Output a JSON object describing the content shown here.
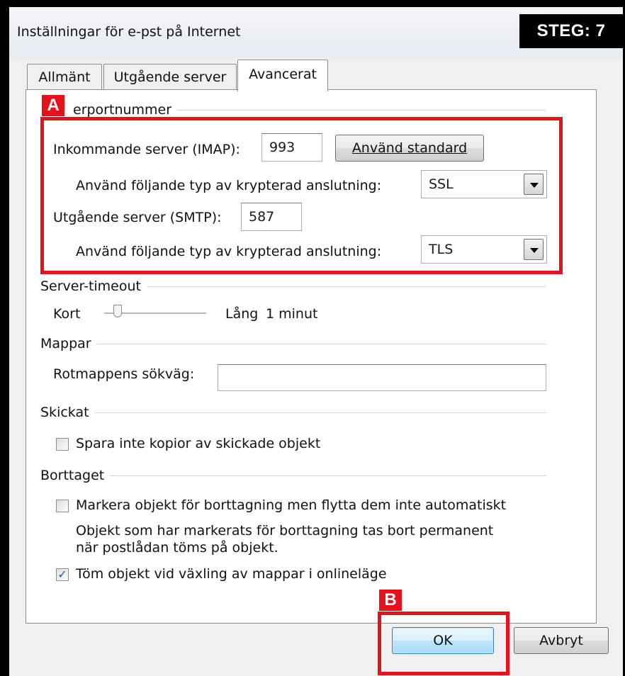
{
  "window": {
    "title": "Inställningar för e-pst på Internet"
  },
  "step_badge": "STEG: 7",
  "tabs": [
    {
      "label": "Allmänt"
    },
    {
      "label": "Utgående server"
    },
    {
      "label": "Avancerat"
    }
  ],
  "ports": {
    "group_label": "A",
    "group_label_rest": "erportnummer",
    "incoming_label": "Inkommande server (IMAP):",
    "incoming_value": "993",
    "use_default_label": "Använd standard",
    "incoming_encryption_label": "Använd följande typ av krypterad anslutning:",
    "incoming_encryption_value": "SSL",
    "outgoing_label": "Utgående server (SMTP):",
    "outgoing_value": "587",
    "outgoing_encryption_label": "Använd följande typ av krypterad anslutning:",
    "outgoing_encryption_value": "TLS"
  },
  "timeout": {
    "group_label": "Server-timeout",
    "short_label": "Kort",
    "long_label": "Lång",
    "value": "1 minut",
    "slider_fraction": 0.1
  },
  "folders": {
    "group_label": "Mappar",
    "root_label": "Rotmappens sökväg:",
    "root_value": ""
  },
  "sent": {
    "group_label": "Skickat",
    "no_copies_label": "Spara inte kopior av skickade objekt",
    "no_copies_checked": false
  },
  "deleted": {
    "group_label": "Borttaget",
    "mark_label": "Markera objekt för borttagning men flytta dem inte automatiskt",
    "mark_checked": false,
    "info_line1": "Objekt som har markerats för borttagning tas bort permanent",
    "info_line2": "när postlådan töms på objekt.",
    "purge_label": "Töm objekt vid växling av mappar i onlineläge",
    "purge_checked": true,
    "purge_check_glyph": "✓"
  },
  "buttons": {
    "ok": "OK",
    "cancel": "Avbryt"
  },
  "annotations": {
    "a": "A",
    "b": "B",
    "color": "#e5121c"
  }
}
